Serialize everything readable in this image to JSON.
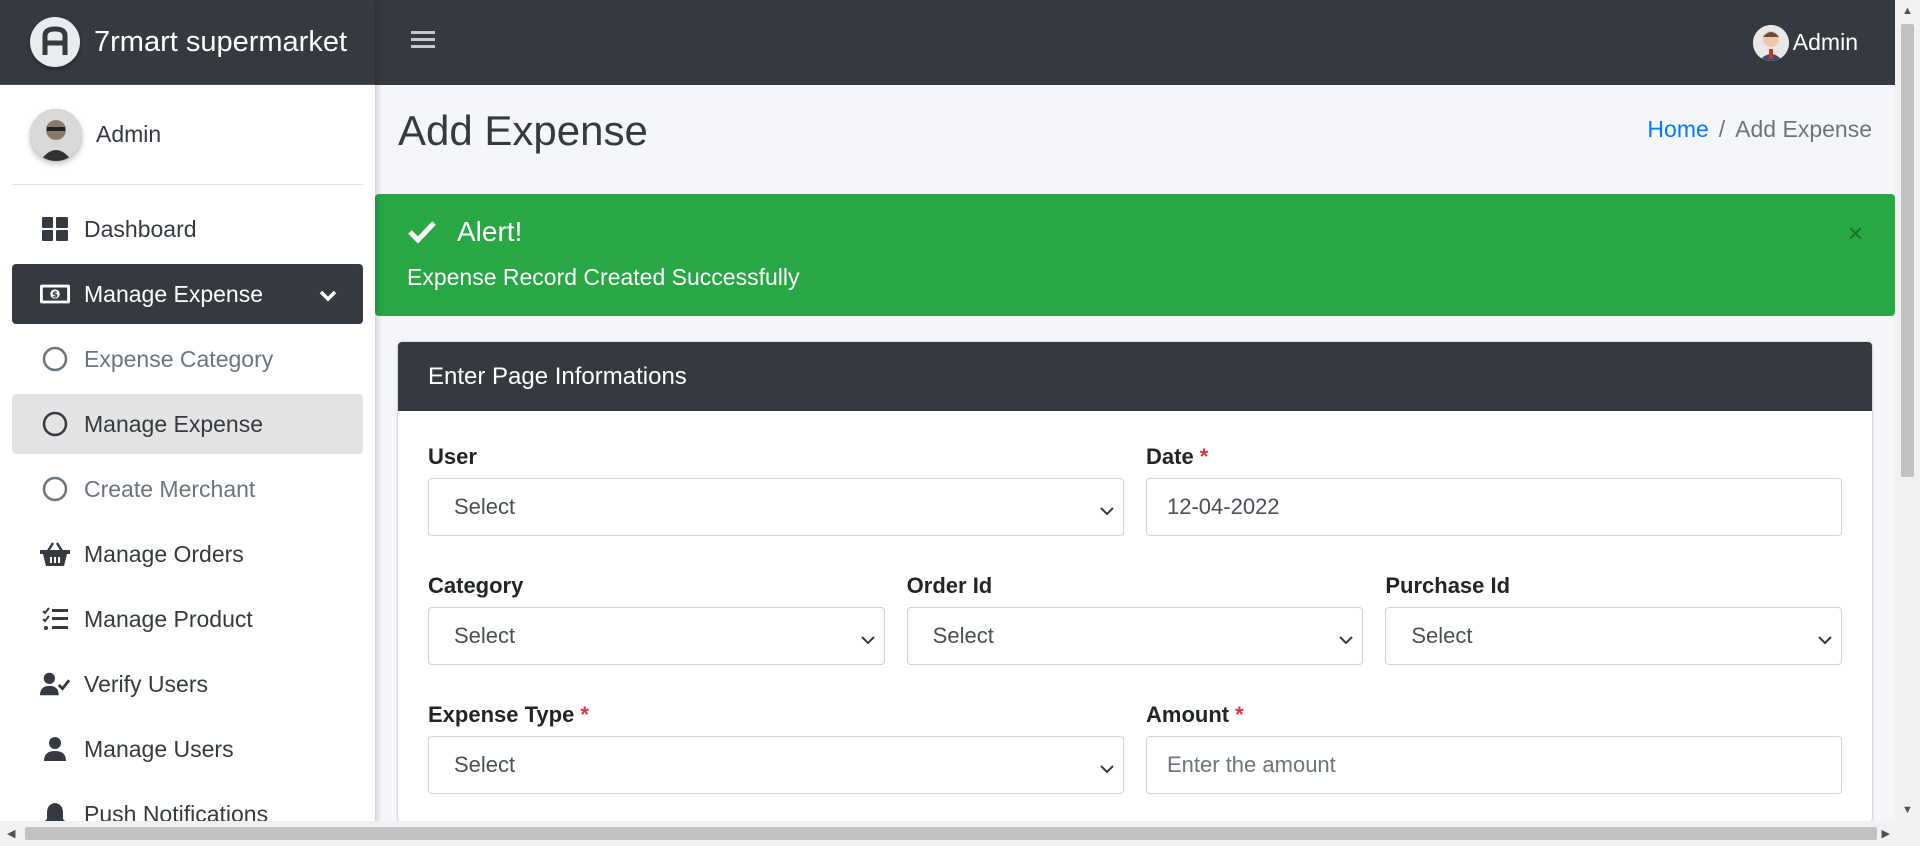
{
  "brand": {
    "name": "7rmart supermarket",
    "logo_icon": "brand-logo-icon"
  },
  "sidebar": {
    "user_name": "Admin",
    "items": [
      {
        "label": "Dashboard",
        "icon": "dashboard-icon"
      },
      {
        "label": "Manage Expense",
        "icon": "money-icon",
        "active": true
      },
      {
        "label": "Expense Category",
        "icon": "circle-icon",
        "sub": true
      },
      {
        "label": "Manage Expense",
        "icon": "circle-icon",
        "sub": true,
        "selected": true
      },
      {
        "label": "Create Merchant",
        "icon": "circle-icon",
        "sub": true
      },
      {
        "label": "Manage Orders",
        "icon": "basket-icon"
      },
      {
        "label": "Manage Product",
        "icon": "list-check-icon"
      },
      {
        "label": "Verify Users",
        "icon": "user-check-icon"
      },
      {
        "label": "Manage Users",
        "icon": "user-icon"
      },
      {
        "label": "Push Notifications",
        "icon": "bell-icon"
      }
    ]
  },
  "topbar": {
    "user_name": "Admin"
  },
  "page": {
    "title": "Add Expense",
    "breadcrumb": {
      "home": "Home",
      "separator": "/",
      "current": "Add Expense"
    }
  },
  "alert": {
    "title": "Alert!",
    "message": "Expense Record Created Successfully",
    "close": "×",
    "color": "#28a745"
  },
  "form": {
    "header": "Enter Page Informations",
    "user": {
      "label": "User",
      "value": "Select"
    },
    "date": {
      "label": "Date",
      "required": "*",
      "value": "12-04-2022"
    },
    "category": {
      "label": "Category",
      "value": "Select"
    },
    "order_id": {
      "label": "Order Id",
      "value": "Select"
    },
    "purchase_id": {
      "label": "Purchase Id",
      "value": "Select"
    },
    "expense_type": {
      "label": "Expense Type",
      "required": "*",
      "value": "Select"
    },
    "amount": {
      "label": "Amount",
      "required": "*",
      "placeholder": "Enter the amount"
    }
  },
  "colors": {
    "dark": "#343a40",
    "success": "#28a745",
    "link": "#007bff",
    "required": "#dc3545"
  }
}
